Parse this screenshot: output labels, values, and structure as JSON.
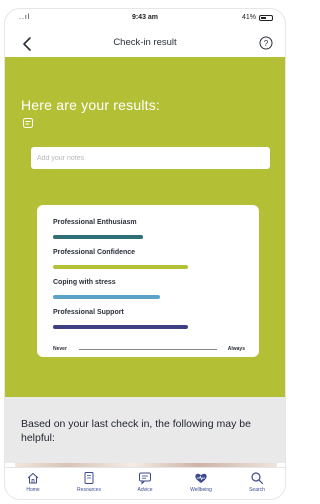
{
  "status_bar": {
    "signal": "..ıl",
    "time": "9:43 am",
    "battery": "41%"
  },
  "header": {
    "title": "Check-in result"
  },
  "results": {
    "heading": "Here are your results:",
    "notes_placeholder": "Add your notes",
    "items": [
      {
        "label": "Professional Enthusiasm",
        "level": 0.58,
        "color": "#2f6f78"
      },
      {
        "label": "Professional Confidence",
        "level": 0.87,
        "color": "#b3c036"
      },
      {
        "label": "Coping with stress",
        "level": 0.69,
        "color": "#5da3c9"
      },
      {
        "label": "Professional Support",
        "level": 0.87,
        "color": "#3f3f86"
      }
    ],
    "scale_min": "Never",
    "scale_max": "Always"
  },
  "helpful": {
    "text": "Based on your last check in, the following may be helpful:"
  },
  "tabs": [
    {
      "label": "Home",
      "icon": "home-icon"
    },
    {
      "label": "Resources",
      "icon": "book-icon"
    },
    {
      "label": "Advice",
      "icon": "chat-icon"
    },
    {
      "label": "Wellbeing",
      "icon": "heart-icon"
    },
    {
      "label": "Search",
      "icon": "search-icon"
    }
  ],
  "colors": {
    "accent_green": "#b3c036",
    "nav_blue": "#3b4a8a",
    "helpful_bg": "#e9e9e9"
  }
}
